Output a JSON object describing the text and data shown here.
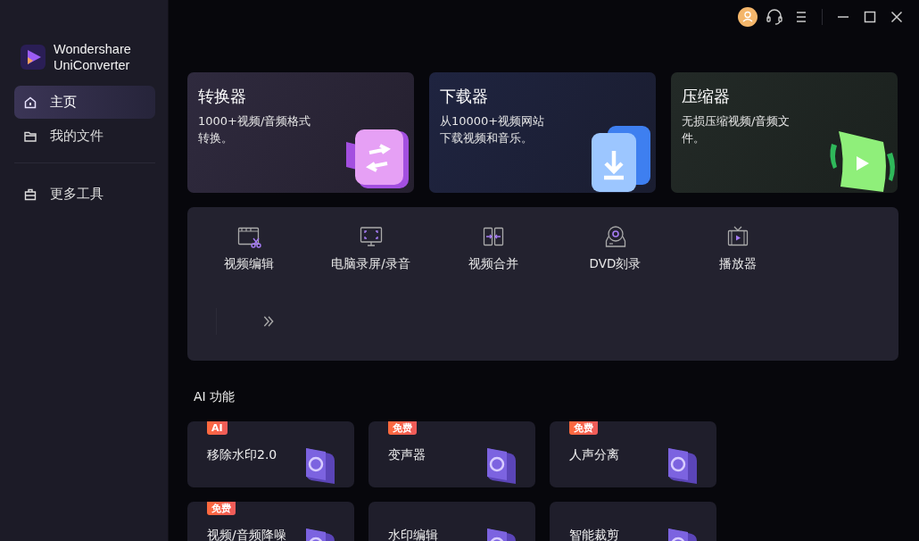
{
  "brand": {
    "lines": [
      "Wondershare",
      "UniConverter"
    ]
  },
  "sidebar": {
    "items": [
      {
        "label": "主页",
        "kind": "home",
        "selected": true
      },
      {
        "label": "我的文件",
        "kind": "folder",
        "selected": false
      },
      {
        "label": "更多工具",
        "kind": "toolbox",
        "selected": false
      }
    ]
  },
  "feature_cards": [
    {
      "title": "转换器",
      "description": "1000+视频/音频格式转换。",
      "kind": "convert"
    },
    {
      "title": "下载器",
      "description": "从10000+视频网站下载视频和音乐。",
      "kind": "download"
    },
    {
      "title": "压缩器",
      "description": "无损压缩视频/音频文件。",
      "kind": "compress"
    }
  ],
  "tools": [
    {
      "label": "视频编辑",
      "kind": "edit"
    },
    {
      "label": "电脑录屏/录音",
      "kind": "record"
    },
    {
      "label": "视频合并",
      "kind": "merge"
    },
    {
      "label": "DVD刻录",
      "kind": "dvd"
    },
    {
      "label": "播放器",
      "kind": "player"
    }
  ],
  "ai_section": {
    "title": "AI 功能",
    "cards": [
      {
        "title": "移除水印2.0",
        "badge": "AI"
      },
      {
        "title": "变声器",
        "badge": "免费"
      },
      {
        "title": "人声分离",
        "badge": "免费"
      },
      {
        "title": "视频/音频降噪",
        "badge": "免费"
      },
      {
        "title": "水印编辑"
      },
      {
        "title": "智能裁剪"
      }
    ]
  }
}
